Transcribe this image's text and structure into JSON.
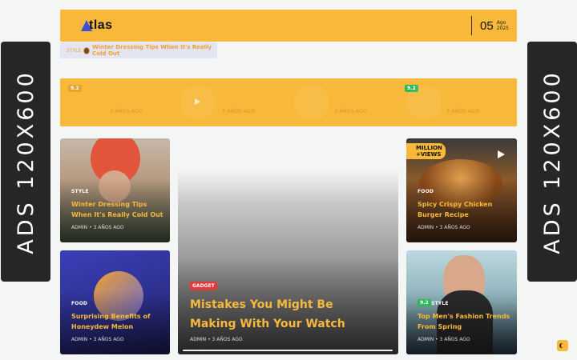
{
  "ads": {
    "left_label": "ADS 120X600",
    "right_label": "ADS 120X600"
  },
  "header": {
    "logo_text": "tlas",
    "date_day": "05",
    "date_month": "Ago",
    "date_year": "2025"
  },
  "ticker": {
    "category": "STYLE",
    "title": "Winter Dressing Tips When It's Really Cold Out"
  },
  "strip": {
    "badge_1": "9.2",
    "badge_2": "9.2",
    "times": [
      "3 AÑOS AGO",
      "3 AÑOS AGO",
      "3 AÑOS AGO",
      "3 AÑOS AGO"
    ]
  },
  "cards": {
    "card_1": {
      "category": "STYLE",
      "title": "Winter Dressing Tips When It's Really Cold Out",
      "meta": "ADMIN • 3 AÑOS AGO"
    },
    "card_2": {
      "category": "FOOD",
      "title": "Surprising Benefits of Honeydew Melon",
      "meta": "ADMIN • 3 AÑOS AGO"
    },
    "card_3": {
      "category": "FOOD",
      "title": "Spicy Crispy Chicken Burger Recipe",
      "meta": "ADMIN • 3 AÑOS AGO",
      "badge_num": "4",
      "badge_line1": "MILLION",
      "badge_line2": "+VIEWS"
    },
    "card_4": {
      "category": "STYLE",
      "score": "9.2",
      "title": "Top Men's Fashion Trends From Spring",
      "meta": "ADMIN • 3 AÑOS AGO"
    },
    "featured": {
      "category": "GADGET",
      "title": "Mistakes You Might Be Making With Your Watch",
      "meta": "ADMIN • 3 AÑOS AGO"
    }
  },
  "colors": {
    "accent": "#f8b93b",
    "ads_bg": "#262626",
    "badge_red": "#e23a3a",
    "badge_green": "#2eb85c"
  }
}
